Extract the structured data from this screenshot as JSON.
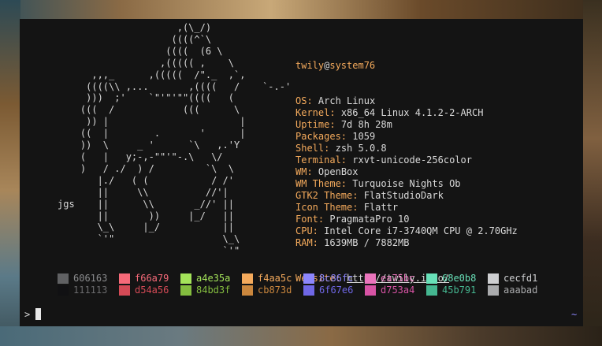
{
  "ascii_art": "                     ,(\\_/)\n                    ((((^`\\\n                   ((((  (6 \\\n                  ,((((( ,    \\\n      ,,,_      ,(((((  /\"._  ,`,\n     ((((\\\\ ,...       ,((((   /    `-.-'\n     )))  ;'    `\"'\"'\"\"((((   (\n    (((  /            (((      \\\n     )) |                       |\n    ((  |        .       '      |\n    ))  \\     _ '      `\\   ,.'Y\n    (   |   y;-,-\"\"'\"-.\\   \\/\n    )   / ./  ) /         `\\  \\\n       |./   ( (           / /'\n       ||     \\\\          //'|\njgs    ||      \\\\       _//' ||\n       ||       ))     |_/   ||\n       \\_\\     |_/           ||\n       `'\"                   \\_\\\n                             `'\"",
  "info": {
    "user": "twily",
    "at": "@",
    "host": "system76",
    "rows": [
      {
        "key": "OS:",
        "value": "Arch Linux"
      },
      {
        "key": "Kernel:",
        "value": "x86_64 Linux 4.1.2-2-ARCH"
      },
      {
        "key": "Uptime:",
        "value": "7d 8h 28m"
      },
      {
        "key": "Packages:",
        "value": "1059"
      },
      {
        "key": "Shell:",
        "value": "zsh 5.0.8"
      },
      {
        "key": "Terminal:",
        "value": "rxvt-unicode-256color"
      },
      {
        "key": "WM:",
        "value": "OpenBox"
      },
      {
        "key": "WM Theme:",
        "value": "Turquoise Nights Ob"
      },
      {
        "key": "GTK2 Theme:",
        "value": "FlatStudioDark"
      },
      {
        "key": "Icon Theme:",
        "value": "Flattr"
      },
      {
        "key": "Font:",
        "value": "PragmataPro 10"
      },
      {
        "key": "CPU:",
        "value": "Intel Core i7-3740QM CPU @ 2.70GHz"
      },
      {
        "key": "RAM:",
        "value": "1639MB / 7882MB"
      }
    ],
    "website_key": "Website:",
    "website_url": "http://twily.info/"
  },
  "palette": {
    "normal": [
      {
        "hex": "606163",
        "color": "#606163"
      },
      {
        "hex": "f66a79",
        "color": "#f66a79"
      },
      {
        "hex": "a4e35a",
        "color": "#a4e35a"
      },
      {
        "hex": "f4aa5c",
        "color": "#f4aa5c"
      },
      {
        "hex": "8c86fc",
        "color": "#8c86fc"
      },
      {
        "hex": "ea75bc",
        "color": "#ea75bc"
      },
      {
        "hex": "68e0b8",
        "color": "#68e0b8"
      },
      {
        "hex": "cecfd1",
        "color": "#cecfd1"
      }
    ],
    "dim": [
      {
        "hex": "111113",
        "color": "#111113"
      },
      {
        "hex": "d54a56",
        "color": "#d54a56"
      },
      {
        "hex": "84bd3f",
        "color": "#84bd3f"
      },
      {
        "hex": "cb873d",
        "color": "#cb873d"
      },
      {
        "hex": "6f67e6",
        "color": "#6f67e6"
      },
      {
        "hex": "d753a4",
        "color": "#d753a4"
      },
      {
        "hex": "45b791",
        "color": "#45b791"
      },
      {
        "hex": "aaabad",
        "color": "#aaabad"
      }
    ]
  },
  "prompt": {
    "symbol": ">",
    "right_indicator": "~"
  },
  "colors": {
    "accent": "#f4aa5c",
    "text": "#d9d9d9",
    "background": "#141414"
  }
}
